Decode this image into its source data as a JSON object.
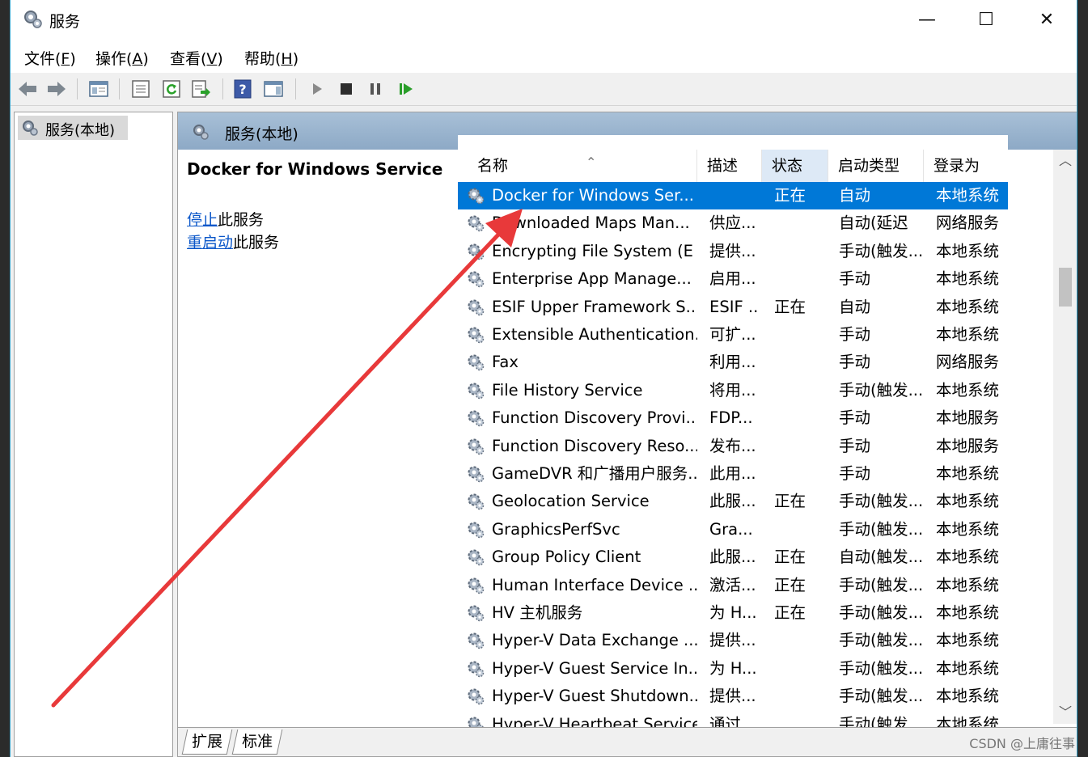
{
  "window": {
    "title": "服务",
    "controls": {
      "minimize": "—",
      "maximize": "☐",
      "close": "✕"
    }
  },
  "menu": [
    {
      "label": "文件(",
      "key": "F",
      "end": ")"
    },
    {
      "label": "操作(",
      "key": "A",
      "end": ")"
    },
    {
      "label": "查看(",
      "key": "V",
      "end": ")"
    },
    {
      "label": "帮助(",
      "key": "H",
      "end": ")"
    }
  ],
  "toolbar": [
    "back-arrow",
    "forward-arrow",
    "show-hide-console-tree",
    "properties",
    "refresh",
    "export-list",
    "help",
    "show-hide-action-pane",
    "start-service",
    "stop-service",
    "pause-service",
    "resume-service"
  ],
  "tree": {
    "root": "服务(本地)"
  },
  "panel": {
    "header": "服务(本地)",
    "selected_name": "Docker for Windows Service",
    "stop_link": "停止",
    "stop_suffix": "此服务",
    "restart_link": "重启动",
    "restart_suffix": "此服务"
  },
  "columns": {
    "name": "名称",
    "desc": "描述",
    "status": "状态",
    "startup": "启动类型",
    "logon": "登录为"
  },
  "rows": [
    {
      "name": "Docker for Windows Ser...",
      "desc": "",
      "status": "正在",
      "startup": "自动",
      "logon": "本地系统",
      "selected": true
    },
    {
      "name": "Downloaded Maps Man...",
      "desc": "供应...",
      "status": "",
      "startup": "自动(延迟",
      "logon": "网络服务"
    },
    {
      "name": "Encrypting File System (E",
      "desc": "提供...",
      "status": "",
      "startup": "手动(触发...",
      "logon": "本地系统"
    },
    {
      "name": "Enterprise App Manage...",
      "desc": "启用...",
      "status": "",
      "startup": "手动",
      "logon": "本地系统"
    },
    {
      "name": "ESIF Upper Framework S...",
      "desc": "ESIF ...",
      "status": "正在",
      "startup": "自动",
      "logon": "本地系统"
    },
    {
      "name": "Extensible Authentication...",
      "desc": "可扩...",
      "status": "",
      "startup": "手动",
      "logon": "本地系统"
    },
    {
      "name": "Fax",
      "desc": "利用...",
      "status": "",
      "startup": "手动",
      "logon": "网络服务"
    },
    {
      "name": "File History Service",
      "desc": "将用...",
      "status": "",
      "startup": "手动(触发...",
      "logon": "本地系统"
    },
    {
      "name": "Function Discovery Provi...",
      "desc": "FDP...",
      "status": "",
      "startup": "手动",
      "logon": "本地服务"
    },
    {
      "name": "Function Discovery Reso...",
      "desc": "发布...",
      "status": "",
      "startup": "手动",
      "logon": "本地服务"
    },
    {
      "name": "GameDVR 和广播用户服务...",
      "desc": "此用...",
      "status": "",
      "startup": "手动",
      "logon": "本地系统"
    },
    {
      "name": "Geolocation Service",
      "desc": "此服...",
      "status": "正在",
      "startup": "手动(触发...",
      "logon": "本地系统"
    },
    {
      "name": "GraphicsPerfSvc",
      "desc": "Gra...",
      "status": "",
      "startup": "手动(触发...",
      "logon": "本地系统"
    },
    {
      "name": "Group Policy Client",
      "desc": "此服...",
      "status": "正在",
      "startup": "自动(触发...",
      "logon": "本地系统"
    },
    {
      "name": "Human Interface Device ...",
      "desc": "激活...",
      "status": "正在",
      "startup": "手动(触发...",
      "logon": "本地系统"
    },
    {
      "name": "HV 主机服务",
      "desc": "为 H...",
      "status": "正在",
      "startup": "手动(触发...",
      "logon": "本地系统"
    },
    {
      "name": "Hyper-V Data Exchange ...",
      "desc": "提供...",
      "status": "",
      "startup": "手动(触发...",
      "logon": "本地系统"
    },
    {
      "name": "Hyper-V Guest Service In...",
      "desc": "为 H...",
      "status": "",
      "startup": "手动(触发...",
      "logon": "本地系统"
    },
    {
      "name": "Hyper-V Guest Shutdown...",
      "desc": "提供...",
      "status": "",
      "startup": "手动(触发...",
      "logon": "本地系统"
    },
    {
      "name": "Hyper-V Heartbeat Service",
      "desc": "通过...",
      "status": "",
      "startup": "手动(触发...",
      "logon": "本地系统"
    }
  ],
  "tabs": [
    "扩展",
    "标准"
  ],
  "scrollbar": {
    "up": "︿",
    "down": "﹀"
  },
  "watermark": "CSDN @上庸往事",
  "colors": {
    "selection": "#0078d7",
    "header_band": "#a8c0d7",
    "annotation_arrow": "#e8393a",
    "link": "#0b57c9"
  }
}
